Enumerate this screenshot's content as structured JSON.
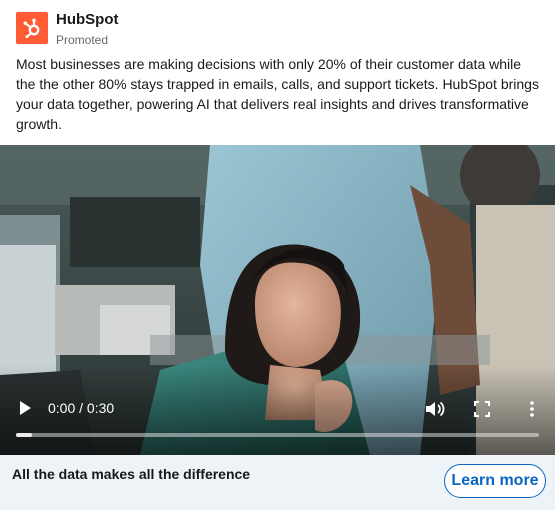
{
  "post": {
    "company_name": "HubSpot",
    "promoted_label": "Promoted",
    "body": "Most businesses are making decisions with only 20% of their customer data while the the other 80% stays trapped in emails, calls, and support tickets. HubSpot brings your data together, powering AI that delivers real insights and drives transformative growth."
  },
  "video": {
    "time": "0:00 / 0:30",
    "progress_fraction": 0.03,
    "controls": [
      "play-icon",
      "volume-icon",
      "fullscreen-icon",
      "more-vertical-icon"
    ]
  },
  "cta": {
    "headline": "All the data makes all the difference",
    "button_label": "Learn more"
  },
  "colors": {
    "brand": "#ff5c35",
    "accent": "#0a66c2",
    "footer_bg": "#eef3f8"
  }
}
